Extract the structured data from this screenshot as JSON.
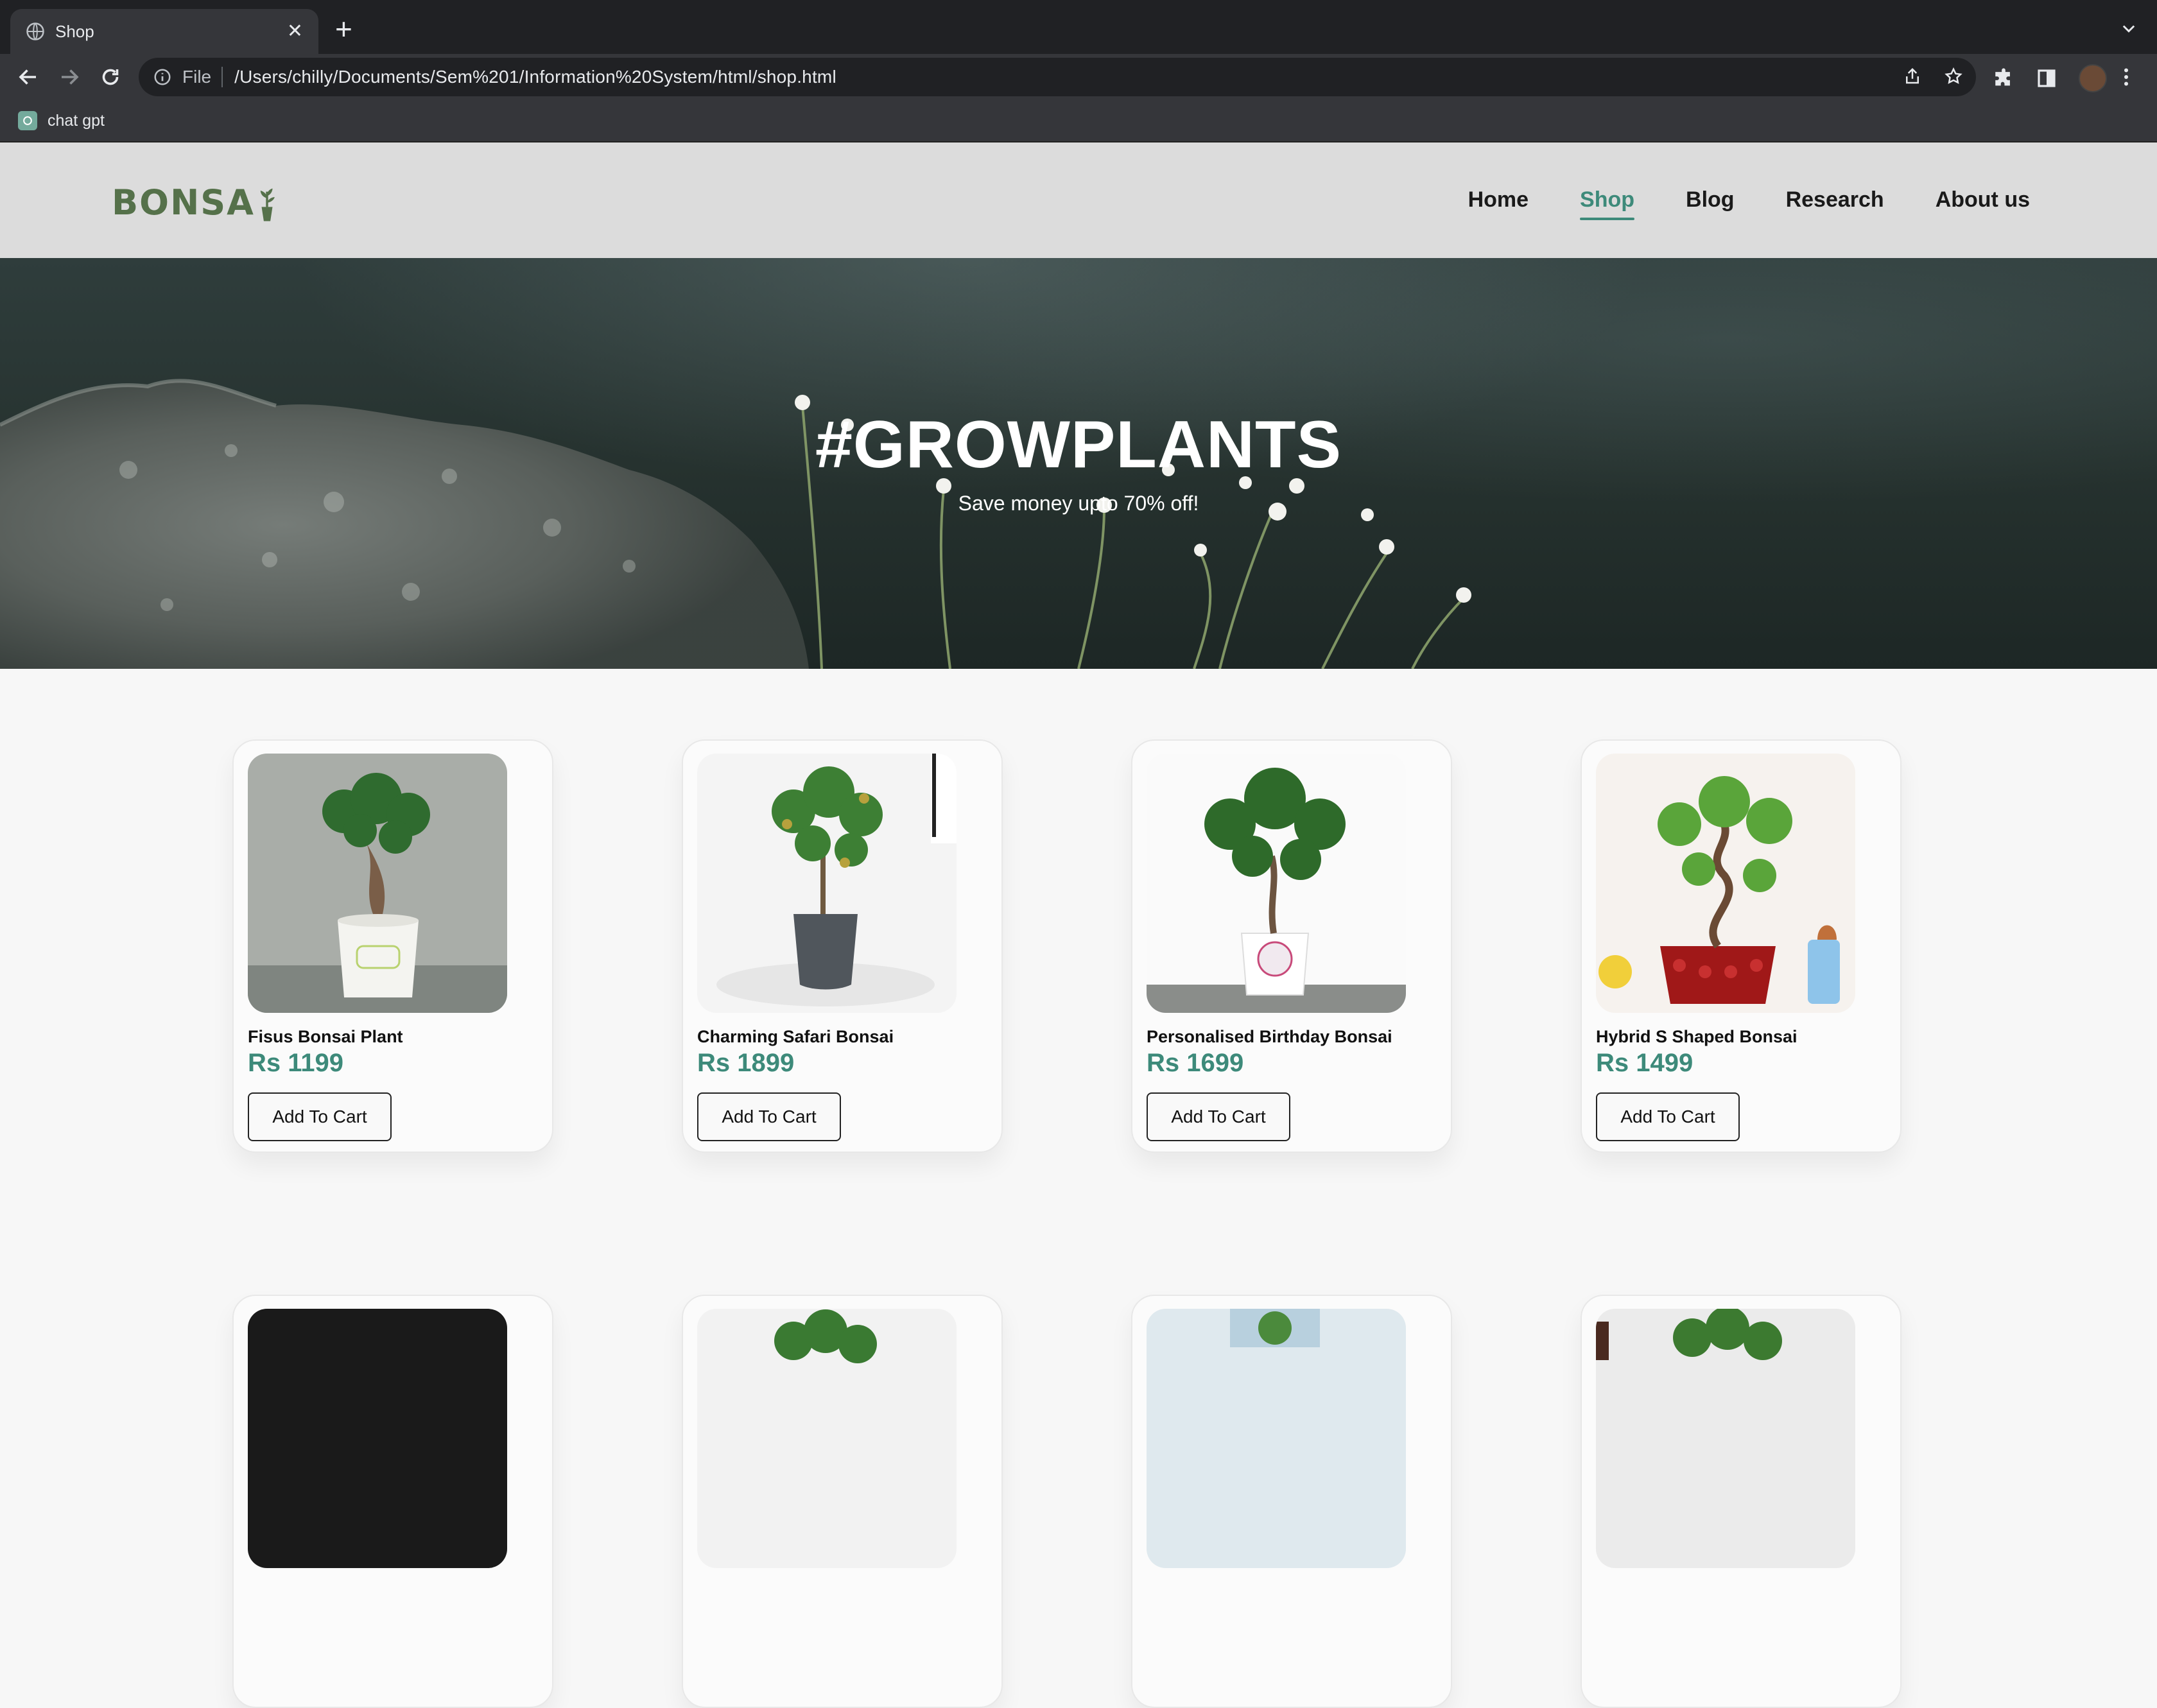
{
  "browser": {
    "tab_title": "Shop",
    "new_tab": "+",
    "omnibox": {
      "scheme_label": "File",
      "url": "/Users/chilly/Documents/Sem%201/Information%20System/html/shop.html"
    },
    "bookmark": "chat gpt"
  },
  "site": {
    "logo": "BONSA",
    "nav": [
      "Home",
      "Shop",
      "Blog",
      "Research",
      "About us"
    ],
    "active_nav": "Shop"
  },
  "hero": {
    "title": "#GROWPLANTS",
    "subtitle": "Save money upto 70% off!"
  },
  "products": [
    {
      "name": "Fisus Bonsai Plant",
      "price": "Rs 1199",
      "button": "Add To Cart"
    },
    {
      "name": "Charming Safari Bonsai",
      "price": "Rs 1899",
      "button": "Add To Cart"
    },
    {
      "name": "Personalised Birthday Bonsai",
      "price": "Rs 1699",
      "button": "Add To Cart"
    },
    {
      "name": "Hybrid S Shaped Bonsai",
      "price": "Rs 1499",
      "button": "Add To Cart"
    }
  ],
  "colors": {
    "accent": "#3d8a7a",
    "logo": "#55714a",
    "header_bg": "#dcdcdc",
    "page_bg": "#f7f7f7"
  }
}
